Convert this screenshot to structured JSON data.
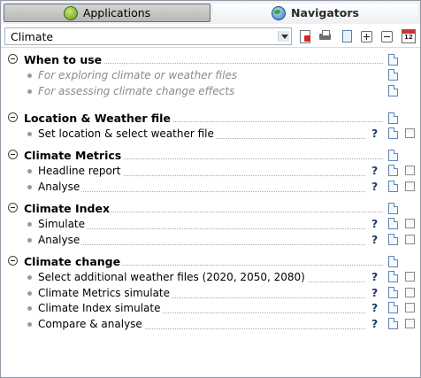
{
  "tabs": {
    "applications": "Applications",
    "navigators": "Navigators"
  },
  "toolbar": {
    "selected_navigator": "Climate",
    "calendar_text": "12"
  },
  "sections": [
    {
      "title": "When to use",
      "items": [
        {
          "label": "For exploring climate or weather files",
          "italic": true
        },
        {
          "label": "For assessing climate change effects",
          "italic": true
        }
      ]
    },
    {
      "title": "Location & Weather file",
      "items": [
        {
          "label": "Set location & select weather file",
          "help": "?"
        }
      ]
    },
    {
      "title": "Climate Metrics",
      "items": [
        {
          "label": "Headline report",
          "help": "?"
        },
        {
          "label": "Analyse",
          "help": "?"
        }
      ]
    },
    {
      "title": "Climate Index",
      "items": [
        {
          "label": "Simulate",
          "help": "?"
        },
        {
          "label": "Analyse",
          "help": "?"
        }
      ]
    },
    {
      "title": "Climate change",
      "items": [
        {
          "label": "Select additional weather files (2020, 2050, 2080)",
          "help": "?"
        },
        {
          "label": "Climate Metrics simulate",
          "help": "?"
        },
        {
          "label": "Climate Index simulate",
          "help": "?"
        },
        {
          "label": "Compare & analyse",
          "help": "?"
        }
      ]
    }
  ]
}
